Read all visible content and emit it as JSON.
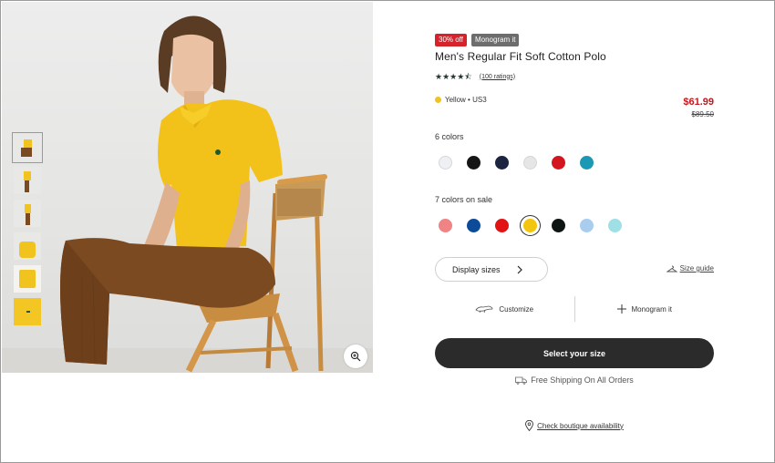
{
  "product": {
    "badges": {
      "discount": "30% off",
      "monogram": "Monogram it"
    },
    "title": "Men's Regular Fit Soft Cotton Polo",
    "stars": "★★★★⯪",
    "rating_value": 4.5,
    "ratings_link": "(100 ratings)",
    "selected_color": "Yellow • US3",
    "price_current": "$61.99",
    "price_original": "$89.50"
  },
  "colors": {
    "regular_label": "6 colors",
    "regular": [
      "#eef0f3",
      "#161616",
      "#1c2440",
      "#e6e6e6",
      "#d3151f",
      "#1a98b4"
    ],
    "sale_label": "7 colors on sale",
    "sale": [
      "#f08383",
      "#0e4a9a",
      "#e31313",
      "#f3c50c",
      "#0f1512",
      "#a8cdee",
      "#9ee0e6"
    ]
  },
  "sizes": {
    "display_label": "Display sizes",
    "guide_label": "Size guide"
  },
  "actions": {
    "customize_label": "Customize",
    "monogram_label": "Monogram it"
  },
  "cta": {
    "label": "Select your size"
  },
  "shipping": {
    "label": "Free Shipping On All Orders"
  },
  "boutique": {
    "label": "Check boutique availability"
  },
  "icons": [
    "zoom-icon",
    "chevron-right-icon",
    "hanger-icon",
    "crocodile-icon",
    "plus-icon",
    "truck-icon",
    "location-pin-icon"
  ]
}
